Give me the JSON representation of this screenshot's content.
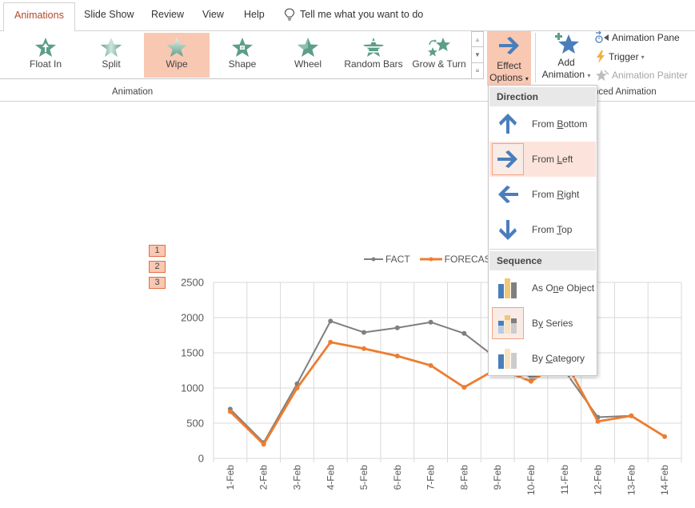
{
  "tabs": [
    {
      "label": "Animations",
      "active": true
    },
    {
      "label": "Slide Show",
      "active": false
    },
    {
      "label": "Review",
      "active": false
    },
    {
      "label": "View",
      "active": false
    },
    {
      "label": "Help",
      "active": false
    }
  ],
  "tellme": {
    "icon": "lightbulb-icon",
    "text": "Tell me what you want to do"
  },
  "ribbon": {
    "gallery": [
      {
        "label": "Float In",
        "icon": "float-in-star-icon",
        "selected": false
      },
      {
        "label": "Split",
        "icon": "split-star-icon",
        "selected": false
      },
      {
        "label": "Wipe",
        "icon": "wipe-star-icon",
        "selected": true
      },
      {
        "label": "Shape",
        "icon": "shape-star-icon",
        "selected": false
      },
      {
        "label": "Wheel",
        "icon": "wheel-star-icon",
        "selected": false
      },
      {
        "label": "Random Bars",
        "icon": "random-bars-star-icon",
        "selected": false
      },
      {
        "label": "Grow & Turn",
        "icon": "grow-turn-star-icon",
        "selected": false
      }
    ],
    "group_animation_label": "Animation",
    "effect_options": {
      "line1": "Effect",
      "line2": "Options",
      "caret": "▾"
    },
    "add_animation": {
      "line1": "Add",
      "line2": "Animation",
      "caret": "▾"
    },
    "animation_pane": "Animation Pane",
    "trigger": "Trigger",
    "trigger_caret": "▾",
    "animation_painter": "Animation Painter",
    "group_advanced_label": "Advanced Animation",
    "group_advanced_visible": "nced Animation"
  },
  "menu": {
    "direction_header": "Direction",
    "direction_items": [
      {
        "pre": "From ",
        "key": "B",
        "post": "ottom",
        "icon": "arrow-up-icon",
        "selected": false
      },
      {
        "pre": "From ",
        "key": "L",
        "post": "eft",
        "icon": "arrow-right-icon",
        "selected": true
      },
      {
        "pre": "From ",
        "key": "R",
        "post": "ight",
        "icon": "arrow-left-icon",
        "selected": false
      },
      {
        "pre": "From ",
        "key": "T",
        "post": "op",
        "icon": "arrow-down-icon",
        "selected": false
      }
    ],
    "sequence_header": "Sequence",
    "sequence_items": [
      {
        "pre": "As O",
        "key": "n",
        "post": "e Object",
        "icon": "as-one-object-icon",
        "selected": false
      },
      {
        "pre": "B",
        "key": "y",
        "post": " Series",
        "icon": "by-series-icon",
        "selected": true
      },
      {
        "pre": "By ",
        "key": "C",
        "post": "ategory",
        "icon": "by-category-icon",
        "selected": false
      }
    ]
  },
  "animation_tags": [
    "1",
    "2",
    "3"
  ],
  "colors": {
    "accent": "#b7472a",
    "selection": "#f8c8b2",
    "fact": "#7f7f7f",
    "forecast": "#ed7d31",
    "icon_blue": "#4a7ebb",
    "star_green": "#5d9e8a"
  },
  "chart_data": {
    "type": "line",
    "title": "",
    "xlabel": "",
    "ylabel": "",
    "categories": [
      "1-Feb",
      "2-Feb",
      "3-Feb",
      "4-Feb",
      "5-Feb",
      "6-Feb",
      "7-Feb",
      "8-Feb",
      "9-Feb",
      "10-Feb",
      "11-Feb",
      "12-Feb",
      "13-Feb",
      "14-Feb"
    ],
    "series": [
      {
        "name": "FACT",
        "color": "#7f7f7f",
        "values": [
          700,
          225,
          1060,
          1950,
          1790,
          1855,
          1935,
          1775,
          1410,
          1150,
          1250,
          585,
          605,
          null
        ]
      },
      {
        "name": "FORECAST",
        "color": "#ed7d31",
        "values": [
          665,
          200,
          1000,
          1650,
          1560,
          1455,
          1320,
          1010,
          1280,
          1095,
          1400,
          525,
          605,
          310
        ]
      }
    ],
    "ylim": [
      0,
      2500
    ],
    "yticks": [
      "0",
      "500",
      "1000",
      "1500",
      "2000",
      "2500"
    ],
    "grid": true,
    "legend": "top",
    "legend_entries": [
      "FACT",
      "FORECAST"
    ],
    "legend_visible_text": [
      "FACT",
      "FORECAS"
    ]
  }
}
